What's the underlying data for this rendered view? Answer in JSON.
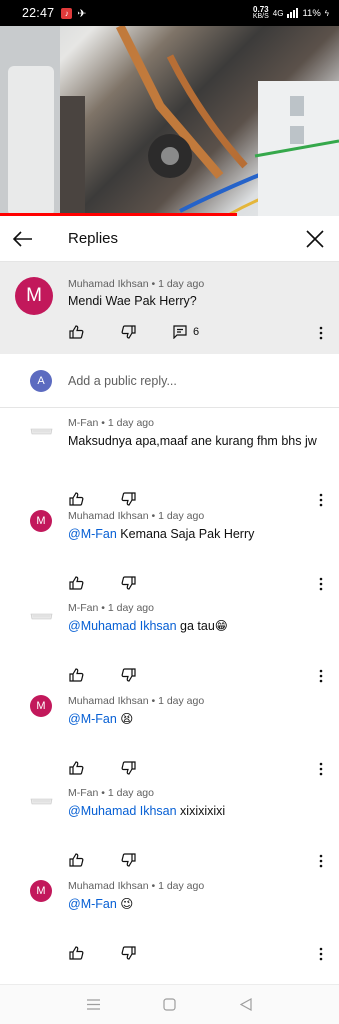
{
  "status": {
    "time": "22:47",
    "speed_value": "0.73",
    "speed_unit": "KB/S",
    "network": "4G",
    "battery": "11%"
  },
  "video": {
    "progress_fraction": 0.7
  },
  "header": {
    "title": "Replies"
  },
  "parent_comment": {
    "author": "Muhamad Ikhsan",
    "time": "1 day ago",
    "avatar_letter": "M",
    "text": "Mendi Wae Pak Herry?",
    "reply_count": "6"
  },
  "add_reply": {
    "avatar_letter": "A",
    "placeholder": "Add a public reply..."
  },
  "replies": [
    {
      "author": "M-Fan",
      "time": "1 day ago",
      "avatar": "logo",
      "mention": "",
      "text": "Maksudnya apa,maaf ane kurang fhm bhs jw"
    },
    {
      "author": "Muhamad Ikhsan",
      "time": "1 day ago",
      "avatar": "M",
      "mention": "@M-Fan",
      "text": " Kemana Saja Pak Herry"
    },
    {
      "author": "M-Fan",
      "time": "1 day ago",
      "avatar": "logo",
      "mention": "@Muhamad Ikhsan",
      "text": " ga tau😁"
    },
    {
      "author": "Muhamad Ikhsan",
      "time": "1 day ago",
      "avatar": "M",
      "mention": "@M-Fan",
      "text": " 😫"
    },
    {
      "author": "M-Fan",
      "time": "1 day ago",
      "avatar": "logo",
      "mention": "@Muhamad Ikhsan",
      "text": " xixixixixi"
    },
    {
      "author": "Muhamad Ikhsan",
      "time": "1 day ago",
      "avatar": "M",
      "mention": "@M-Fan",
      "text": " 😉"
    }
  ],
  "meta_separator": " • ",
  "colors": {
    "accent": "#065fd4",
    "avatar_m": "#c2185b",
    "avatar_a": "#5c6bc0",
    "progress": "#ff0000"
  }
}
